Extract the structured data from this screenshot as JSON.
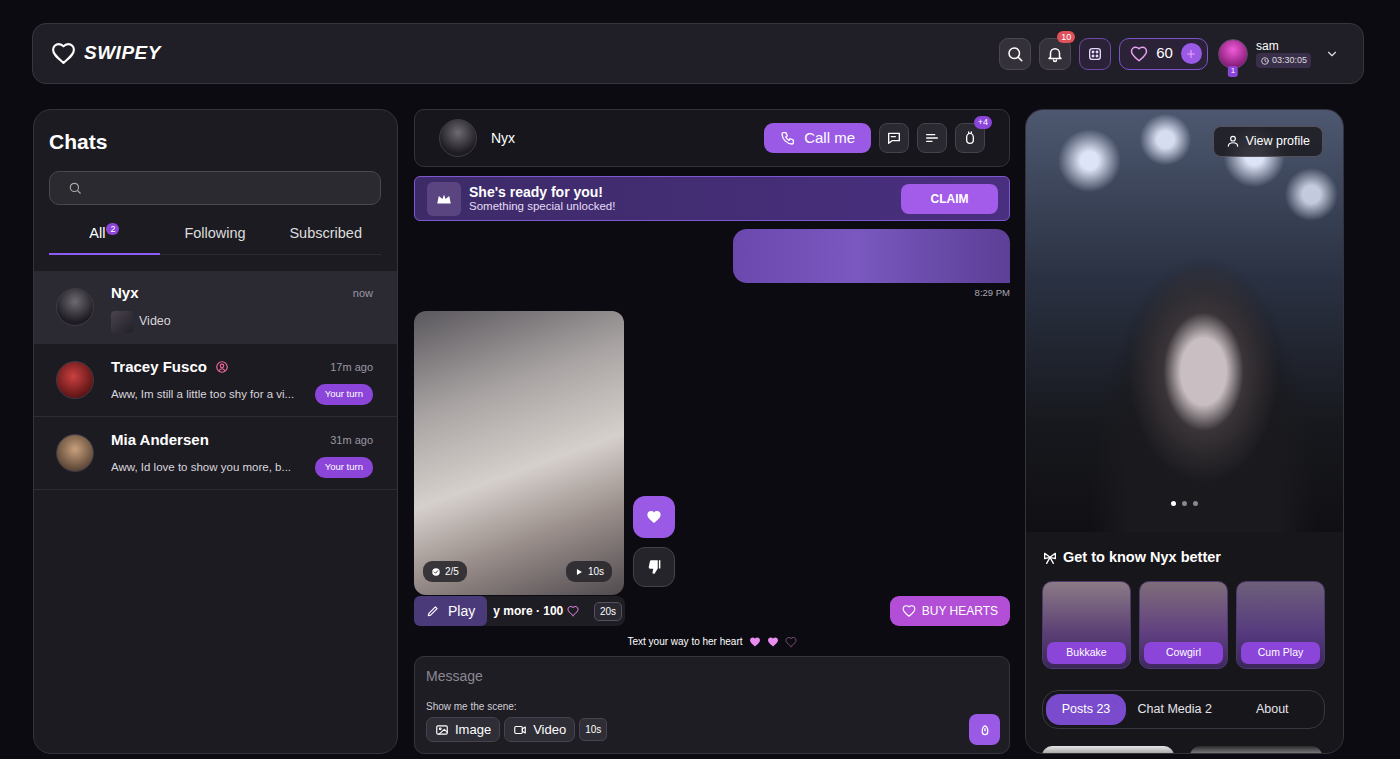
{
  "brand": {
    "name": "SWIPEY"
  },
  "topbar": {
    "notifications": "10",
    "hearts": "60",
    "user": {
      "name": "sam",
      "level": "1",
      "timer": "03:30:05"
    }
  },
  "chats": {
    "title": "Chats",
    "tabs": [
      {
        "label": "All",
        "badge": "2",
        "selected": true
      },
      {
        "label": "Following",
        "selected": false
      },
      {
        "label": "Subscribed",
        "selected": false
      }
    ],
    "items": [
      {
        "name": "Nyx",
        "time": "now",
        "preview": "Video",
        "kind": "media",
        "verified": false,
        "selected": true
      },
      {
        "name": "Tracey Fusco",
        "time": "17m ago",
        "preview": "Aww, Im still a little too shy for a vi...",
        "kind": "text",
        "verified": true,
        "tag": "Your turn",
        "selected": false
      },
      {
        "name": "Mia Andersen",
        "time": "31m ago",
        "preview": "Aww, Id love to show you more, b...",
        "kind": "text",
        "verified": false,
        "tag": "Your turn",
        "selected": false
      }
    ]
  },
  "conversation": {
    "name": "Nyx",
    "call": "Call me",
    "more_badge": "+4"
  },
  "banner": {
    "title": "She's ready for you!",
    "subtitle": "Something special unlocked!",
    "action": "CLAIM"
  },
  "messages": [
    {
      "kind": "sent",
      "time": "8:29 PM"
    },
    {
      "kind": "media",
      "count": "2/5",
      "duration": "10s"
    }
  ],
  "unlock": {
    "play": "Play",
    "price": "y more · 100",
    "timer": "20s",
    "buy": "BUY HEARTS"
  },
  "hint": {
    "text": "Text your way to her heart",
    "hearts": [
      {
        "filled": true
      },
      {
        "filled": true
      },
      {
        "filled": false
      }
    ]
  },
  "composer": {
    "placeholder": "Message",
    "scene_label": "Show me the scene:",
    "options": [
      {
        "label": "Image",
        "kind": "image"
      },
      {
        "label": "Video",
        "kind": "video"
      }
    ],
    "duration": "10s"
  },
  "profile": {
    "view": "View profile",
    "slides": [
      {
        "selected": true
      },
      {
        "selected": false
      },
      {
        "selected": false
      }
    ],
    "heading": "Get to know Nyx better",
    "scenes": [
      "Bukkake",
      "Cowgirl",
      "Cum Play"
    ],
    "tabs": [
      {
        "label": "Posts 23",
        "selected": true
      },
      {
        "label": "Chat Media 2",
        "selected": false
      },
      {
        "label": "About",
        "selected": false
      }
    ]
  }
}
